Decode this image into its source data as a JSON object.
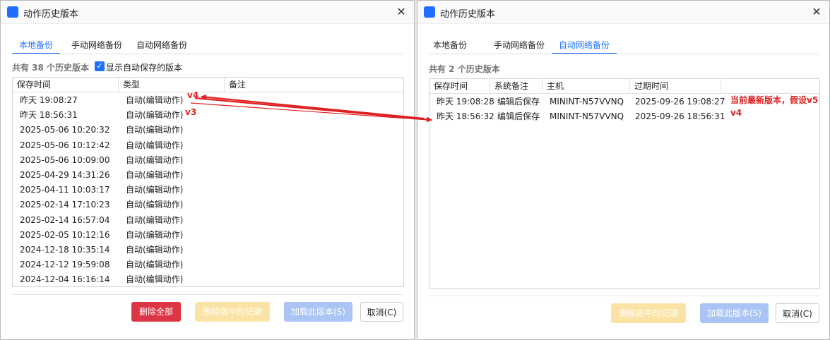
{
  "colors": {
    "accent": "#1e6fff",
    "danger": "#dc3545",
    "annotation": "#e02020"
  },
  "window1": {
    "title": "动作历史版本",
    "tabs": [
      "本地备份",
      "手动网络备份",
      "自动网络备份"
    ],
    "active_tab": "本地备份",
    "count": "共有 38 个历史版本",
    "show_autosave_label": "显示自动保存的版本",
    "columns": [
      "保存时间",
      "类型",
      "备注"
    ],
    "rows": [
      [
        "昨天 19:08:27",
        "自动(编辑动作)",
        ""
      ],
      [
        "昨天 18:56:31",
        "自动(编辑动作)",
        ""
      ],
      [
        "2025-05-06 10:20:32",
        "自动(编辑动作)",
        ""
      ],
      [
        "2025-05-06 10:12:42",
        "自动(编辑动作)",
        ""
      ],
      [
        "2025-05-06 10:09:00",
        "自动(编辑动作)",
        ""
      ],
      [
        "2025-04-29 14:31:26",
        "自动(编辑动作)",
        ""
      ],
      [
        "2025-04-11 10:03:17",
        "自动(编辑动作)",
        ""
      ],
      [
        "2025-02-14 17:10:23",
        "自动(编辑动作)",
        ""
      ],
      [
        "2025-02-14 16:57:04",
        "自动(编辑动作)",
        ""
      ],
      [
        "2025-02-05 10:12:16",
        "自动(编辑动作)",
        ""
      ],
      [
        "2024-12-18 10:35:14",
        "自动(编辑动作)",
        ""
      ],
      [
        "2024-12-12 19:59:08",
        "自动(编辑动作)",
        ""
      ],
      [
        "2024-12-04 16:16:14",
        "自动(编辑动作)",
        ""
      ]
    ],
    "buttons": {
      "delete_all": "删除全部",
      "delete_selected": "删除选中的记录",
      "load_version": "加载此版本(S)",
      "cancel": "取消(C)"
    }
  },
  "window2": {
    "title": "动作历史版本",
    "tabs": [
      "本地备份",
      "手动网络备份",
      "自动网络备份"
    ],
    "active_tab": "自动网络备份",
    "count": "共有 2 个历史版本",
    "columns": [
      "保存时间",
      "系统备注",
      "主机",
      "过期时间"
    ],
    "rows": [
      [
        "昨天 19:08:28",
        "编辑后保存",
        "MININT-N57VVNQ",
        "2025-09-26 19:08:27"
      ],
      [
        "昨天 18:56:32",
        "编辑后保存",
        "MININT-N57VVNQ",
        "2025-09-26 18:56:31"
      ]
    ],
    "buttons": {
      "delete_selected": "删除选中的记录",
      "load_version": "加载此版本(S)",
      "cancel": "取消(C)"
    }
  },
  "annotations": {
    "left_v4": "v4",
    "left_v3": "v3",
    "right_latest": "当前最新版本，假设v5",
    "right_v4": "v4"
  }
}
